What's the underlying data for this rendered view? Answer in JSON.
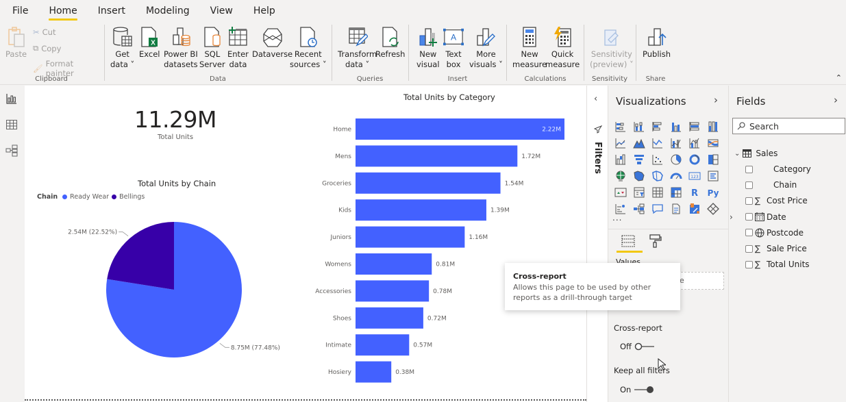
{
  "menu": {
    "tabs": [
      {
        "label": "File"
      },
      {
        "label": "Home",
        "active": true
      },
      {
        "label": "Insert"
      },
      {
        "label": "Modeling"
      },
      {
        "label": "View"
      },
      {
        "label": "Help"
      }
    ]
  },
  "ribbon": {
    "clipboard": {
      "label": "Clipboard",
      "paste": "Paste",
      "cut": "Cut",
      "copy": "Copy",
      "format_painter": "Format painter"
    },
    "data": {
      "label": "Data",
      "get_data": [
        "Get",
        "data"
      ],
      "excel": "Excel",
      "powerbi": [
        "Power BI",
        "datasets"
      ],
      "sql": [
        "SQL",
        "Server"
      ],
      "enter": [
        "Enter",
        "data"
      ],
      "dataverse": "Dataverse",
      "recent": [
        "Recent",
        "sources"
      ]
    },
    "queries": {
      "label": "Queries",
      "transform": [
        "Transform",
        "data"
      ],
      "refresh": "Refresh"
    },
    "insert": {
      "label": "Insert",
      "new_visual": [
        "New",
        "visual"
      ],
      "text_box": [
        "Text",
        "box"
      ],
      "more_visuals": [
        "More",
        "visuals"
      ]
    },
    "calculations": {
      "label": "Calculations",
      "new_measure": [
        "New",
        "measure"
      ],
      "quick_measure": [
        "Quick",
        "measure"
      ]
    },
    "sensitivity": {
      "label": "Sensitivity",
      "btn": [
        "Sensitivity",
        "(preview)"
      ]
    },
    "share": {
      "label": "Share",
      "publish": "Publish"
    }
  },
  "card": {
    "value": "11.29M",
    "label": "Total Units"
  },
  "chart_data": [
    {
      "type": "pie",
      "title": "Total Units by Chain",
      "legend_title": "Chain",
      "legend_position": "top-left",
      "slices": [
        {
          "name": "Ready Wear",
          "value": 8.75,
          "percent": 77.48,
          "label": "8.75M (77.48%)",
          "color": "#4361ff"
        },
        {
          "name": "Bellings",
          "value": 2.54,
          "percent": 22.52,
          "label": "2.54M (22.52%)",
          "color": "#3700a8"
        }
      ],
      "units": "M"
    },
    {
      "type": "bar",
      "orientation": "horizontal",
      "title": "Total Units by Category",
      "categories": [
        "Home",
        "Mens",
        "Groceries",
        "Kids",
        "Juniors",
        "Womens",
        "Accessories",
        "Shoes",
        "Intimate",
        "Hosiery"
      ],
      "values": [
        2.22,
        1.72,
        1.54,
        1.39,
        1.16,
        0.81,
        0.78,
        0.72,
        0.57,
        0.38
      ],
      "labels": [
        "2.22M",
        "1.72M",
        "1.54M",
        "1.39M",
        "1.16M",
        "0.81M",
        "0.78M",
        "0.72M",
        "0.57M",
        "0.38M"
      ],
      "xlim": [
        0,
        2.22
      ],
      "color": "#4361ff",
      "grid": false
    }
  ],
  "filters": {
    "label": "Filters"
  },
  "visualizations": {
    "title": "Visualizations",
    "icons": [
      "stacked-bar",
      "stacked-column",
      "clustered-bar",
      "clustered-column",
      "100-stacked-bar",
      "100-stacked-column",
      "line",
      "area",
      "stacked-area",
      "line-clustered-column",
      "line-stacked-column",
      "ribbon",
      "waterfall",
      "funnel",
      "scatter",
      "pie",
      "donut",
      "treemap",
      "map",
      "filled-map",
      "shape-map",
      "gauge",
      "card",
      "multi-row-card",
      "kpi",
      "slicer",
      "table",
      "matrix",
      "r-script",
      "python",
      "key-influencers",
      "decomposition-tree",
      "qa",
      "smart-narrative",
      "paginated",
      "power-apps"
    ],
    "more": "...",
    "values_label": "Values",
    "drop_hint": "ere",
    "cross_report_label": "Cross-report",
    "cross_report_state": "Off",
    "keep_filters_label": "Keep all filters",
    "keep_filters_state": "On"
  },
  "tooltip": {
    "title": "Cross-report",
    "body": "Allows this page to be used by other reports as a drill-through target"
  },
  "fields": {
    "title": "Fields",
    "search_placeholder": "Search",
    "table": "Sales",
    "items": [
      {
        "name": "Category",
        "type": "text"
      },
      {
        "name": "Chain",
        "type": "text"
      },
      {
        "name": "Cost Price",
        "type": "sum"
      },
      {
        "name": "Date",
        "type": "date"
      },
      {
        "name": "Postcode",
        "type": "geo"
      },
      {
        "name": "Sale Price",
        "type": "sum"
      },
      {
        "name": "Total Units",
        "type": "sum"
      }
    ]
  }
}
